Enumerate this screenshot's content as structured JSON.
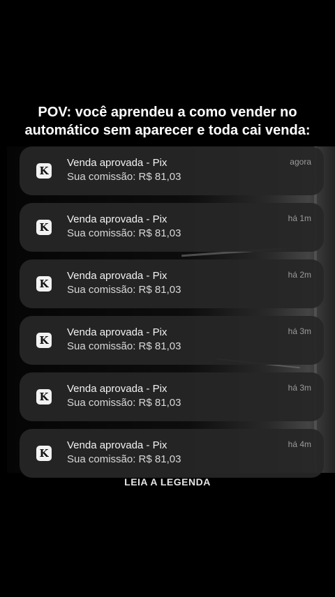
{
  "headline": {
    "line1": "POV: você aprendeu a como vender no",
    "line2": "automático sem aparecer e toda cai venda:"
  },
  "notifications": [
    {
      "icon": "K",
      "title": "Venda aprovada - Pix",
      "body": "Sua comissão: R$ 81,03",
      "time": "agora"
    },
    {
      "icon": "K",
      "title": "Venda aprovada - Pix",
      "body": "Sua comissão: R$ 81,03",
      "time": "há 1m"
    },
    {
      "icon": "K",
      "title": "Venda aprovada - Pix",
      "body": "Sua comissão: R$ 81,03",
      "time": "há 2m"
    },
    {
      "icon": "K",
      "title": "Venda aprovada - Pix",
      "body": "Sua comissão: R$ 81,03",
      "time": "há 3m"
    },
    {
      "icon": "K",
      "title": "Venda aprovada - Pix",
      "body": "Sua comissão: R$ 81,03",
      "time": "há 3m"
    },
    {
      "icon": "K",
      "title": "Venda aprovada - Pix",
      "body": "Sua comissão: R$ 81,03",
      "time": "há 4m"
    }
  ],
  "caption": "LEIA A LEGENDA",
  "colors": {
    "background": "#000000",
    "card": "#262626",
    "icon_bg": "#f2f2f2"
  }
}
